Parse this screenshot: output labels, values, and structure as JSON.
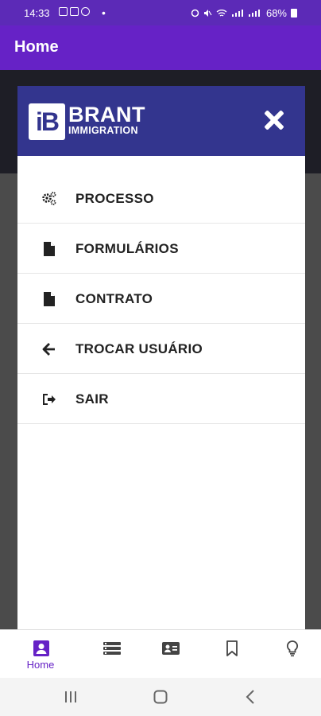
{
  "status_bar": {
    "time": "14:33",
    "battery_percent": "68%",
    "icons": [
      "gallery-icon",
      "youtube-icon",
      "notification-icon",
      "alarm-icon",
      "mute-icon",
      "wifi-icon",
      "lte-signal-icon",
      "lte-signal-icon",
      "battery-icon"
    ]
  },
  "app_bar": {
    "title": "Home"
  },
  "drawer": {
    "logo": {
      "monogram": "iB",
      "brand": "BRANT",
      "sub": "IMMIGRATION"
    },
    "close_icon": "close-icon",
    "items": [
      {
        "label": "PROCESSO",
        "icon": "gears-icon"
      },
      {
        "label": "FORMULÁRIOS",
        "icon": "file-icon"
      },
      {
        "label": "CONTRATO",
        "icon": "file-icon"
      },
      {
        "label": "TROCAR USUÁRIO",
        "icon": "arrow-left-icon"
      },
      {
        "label": "SAIR",
        "icon": "sign-out-icon"
      }
    ]
  },
  "bottom_nav": {
    "items": [
      {
        "label": "Home",
        "icon": "user-square-icon",
        "active": true
      },
      {
        "label": "",
        "icon": "list-icon"
      },
      {
        "label": "",
        "icon": "id-card-icon"
      },
      {
        "label": "",
        "icon": "bookmark-icon"
      },
      {
        "label": "",
        "icon": "lightbulb-icon"
      }
    ]
  },
  "colors": {
    "accent": "#6622c6",
    "drawer_header": "#33358e",
    "status_bar": "#5c2ab7"
  }
}
